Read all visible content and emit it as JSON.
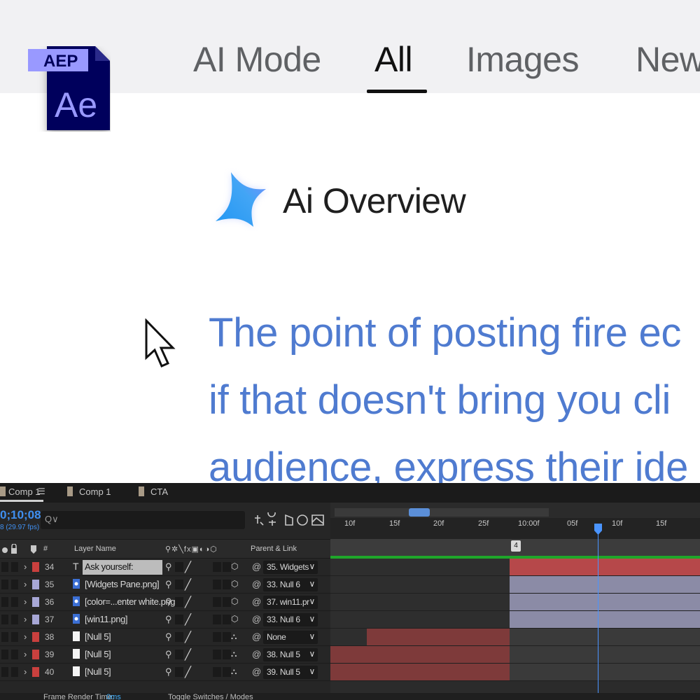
{
  "search_page": {
    "tabs": [
      {
        "label": "AI Mode"
      },
      {
        "label": "All",
        "active": true
      },
      {
        "label": "Images"
      },
      {
        "label": "New"
      }
    ],
    "file_badge": {
      "tag": "AEP",
      "app": "Ae",
      "color": "#00005b",
      "accent": "#9999ff"
    },
    "overview": {
      "title": "Ai Overview",
      "icon": "sparkle-icon"
    },
    "answer_lines": [
      "The point of posting fire ec",
      "if that doesn't bring you cli",
      "audience, express their ide"
    ],
    "answer_color": "#4f7bd0"
  },
  "after_effects": {
    "tabs": [
      {
        "label": "Comp 1",
        "active": true
      },
      {
        "label": "Comp 1"
      },
      {
        "label": "CTA"
      }
    ],
    "time_code": "0;10;08",
    "fps": "8 (29.97 fps)",
    "search_placeholder": "Q∨",
    "columns": {
      "layer_name": "Layer Name",
      "parent_link": "Parent & Link",
      "hash": "#"
    },
    "ruler_ticks": [
      "10f",
      "15f",
      "20f",
      "25f",
      "10:00f",
      "05f",
      "10f",
      "15f"
    ],
    "marker_label": "4",
    "layers": [
      {
        "num": "34",
        "type": "T",
        "name": "Ask yourself:",
        "label_color": "#c9403e",
        "parent": "35. Widgets",
        "selected": true
      },
      {
        "num": "35",
        "type": "img",
        "name": "[Widgets Pane.png]",
        "label_color": "#a7a7d6",
        "parent": "33. Null 6"
      },
      {
        "num": "36",
        "type": "img",
        "name": "[color=...enter white.png]",
        "label_color": "#a7a7d6",
        "parent": "37. win11.pr"
      },
      {
        "num": "37",
        "type": "img",
        "name": "[win11.png]",
        "label_color": "#a7a7d6",
        "parent": "33. Null 6"
      },
      {
        "num": "38",
        "type": "null",
        "name": "[Null 5]",
        "label_color": "#c9403e",
        "parent": "None"
      },
      {
        "num": "39",
        "type": "null",
        "name": "[Null 5]",
        "label_color": "#c9403e",
        "parent": "38. Null 5"
      },
      {
        "num": "40",
        "type": "null",
        "name": "[Null 5]",
        "label_color": "#c9403e",
        "parent": "39. Null 5"
      }
    ],
    "footer": {
      "render_time": "Frame Render Time:",
      "render_value": "0ms",
      "toggle": "Toggle Switches / Modes"
    }
  }
}
